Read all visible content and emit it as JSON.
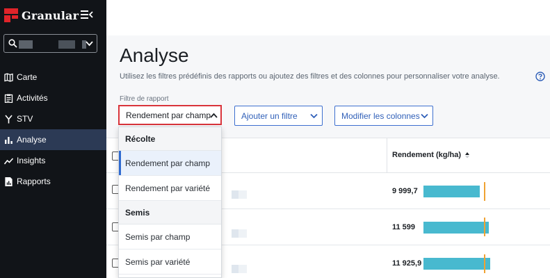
{
  "app": {
    "name": "Granular"
  },
  "sidebar": {
    "nav": [
      {
        "label": "Carte",
        "icon": "map-icon"
      },
      {
        "label": "Activités",
        "icon": "clipboard-icon"
      },
      {
        "label": "STV",
        "icon": "fork-icon"
      },
      {
        "label": "Analyse",
        "icon": "bar-chart-icon",
        "active": true
      },
      {
        "label": "Insights",
        "icon": "trend-line-icon"
      },
      {
        "label": "Rapports",
        "icon": "report-icon"
      }
    ]
  },
  "page": {
    "title": "Analyse",
    "subtitle": "Utilisez les filtres prédéfinis des rapports ou ajoutez des filtres et des colonnes pour personnaliser votre analyse."
  },
  "filters": {
    "report_filter_label": "Filtre de rapport",
    "report_filter_value": "Rendement par champ",
    "add_filter_label": "Ajouter un filtre",
    "modify_columns_label": "Modifier les colonnes"
  },
  "dropdown": {
    "groups": [
      {
        "label": "Récolte",
        "items": [
          {
            "label": "Rendement par champ",
            "selected": true
          },
          {
            "label": "Rendement par variété",
            "selected": false
          }
        ]
      },
      {
        "label": "Semis",
        "items": [
          {
            "label": "Semis par champ",
            "selected": false
          },
          {
            "label": "Semis par variété",
            "selected": false
          }
        ]
      }
    ]
  },
  "table": {
    "yield_header": "Rendement (kg/ha)",
    "rows": [
      {
        "yield": "9 999,7",
        "bar_fraction": 0.62
      },
      {
        "yield": "11 599",
        "bar_fraction": 0.72
      },
      {
        "yield": "11 925,9",
        "bar_fraction": 0.74
      }
    ]
  },
  "colors": {
    "sidebar_bg": "#111418",
    "active_nav": "#2c3a55",
    "accent_blue": "#2f5fb8",
    "highlight_red": "#d9343b",
    "bar": "#48b9cf",
    "marker": "#f0a232"
  }
}
